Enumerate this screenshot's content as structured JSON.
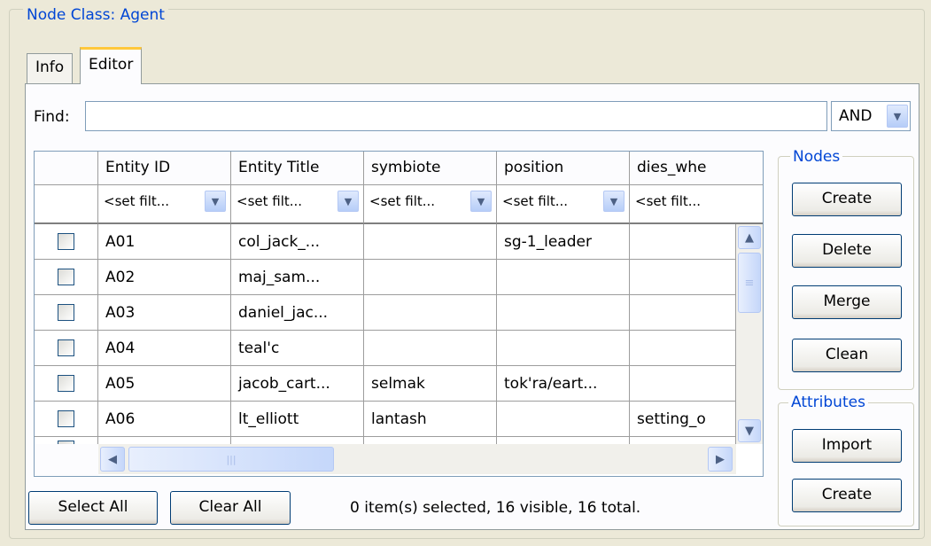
{
  "group_title": "Node Class: Agent",
  "tabs": [
    {
      "label": "Info",
      "active": false
    },
    {
      "label": "Editor",
      "active": true
    }
  ],
  "find": {
    "label": "Find:",
    "value": "",
    "operator": "AND"
  },
  "table": {
    "columns": [
      "Entity ID",
      "Entity Title",
      "symbiote",
      "position",
      "dies_whe"
    ],
    "filter_placeholder": "<set filt...",
    "rows": [
      {
        "checked": false,
        "cells": [
          "A01",
          "col_jack_...",
          "",
          "sg-1_leader",
          ""
        ]
      },
      {
        "checked": false,
        "cells": [
          "A02",
          "maj_sam...",
          "",
          "",
          ""
        ]
      },
      {
        "checked": false,
        "cells": [
          "A03",
          "daniel_jac...",
          "",
          "",
          ""
        ]
      },
      {
        "checked": false,
        "cells": [
          "A04",
          "teal'c",
          "",
          "",
          ""
        ]
      },
      {
        "checked": false,
        "cells": [
          "A05",
          "jacob_cart...",
          "selmak",
          "tok'ra/eart...",
          ""
        ]
      },
      {
        "checked": false,
        "cells": [
          "A06",
          "lt_elliott",
          "lantash",
          "",
          "setting_o"
        ]
      }
    ]
  },
  "nodes_group": {
    "title": "Nodes",
    "buttons": [
      "Create",
      "Delete",
      "Merge",
      "Clean"
    ]
  },
  "attributes_group": {
    "title": "Attributes",
    "buttons": [
      "Import",
      "Create"
    ]
  },
  "footer": {
    "select_all": "Select All",
    "clear_all": "Clear All",
    "status": "0 item(s) selected, 16 visible, 16 total."
  },
  "colors": {
    "accent": "#0046d5",
    "tab_highlight": "#ffc83c",
    "border": "#7f9db9"
  }
}
